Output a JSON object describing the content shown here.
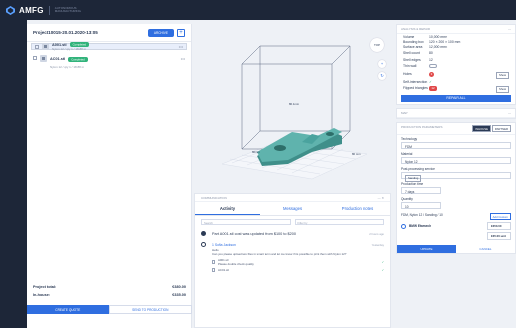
{
  "brand": {
    "name": "AMFG",
    "tagline": "AUTONOMOUS MANUFACTURING"
  },
  "project": {
    "name": "Project10015-20.01.2020-13:05",
    "action_label": "ARCHIVE",
    "add_label": "+",
    "parts": [
      {
        "name": "A001.stl",
        "sub": "Nylon 12 / qty 1 / 18.88 m",
        "badge": "Completed"
      },
      {
        "name": "AC01.stl",
        "sub": "Nylon 12 / qty 1 / 18.88 m",
        "badge": "Completed"
      }
    ],
    "totals": [
      {
        "label": "Project total:",
        "value": "€380.00"
      },
      {
        "label": "In-house:",
        "value": "€335.00"
      }
    ],
    "create_label": "CREATE QUOTE",
    "send_label": "SEND TO PRODUCTION"
  },
  "viewer": {
    "dim_label": "80.1mm",
    "dim_label2": "80mm",
    "dim_label3": "80 mm",
    "reset_label": "?",
    "toolbar": [
      "+",
      "↻"
    ]
  },
  "communication": {
    "header": "COMMUNICATION",
    "header_ctrl": "— ✕",
    "tabs": [
      "Activity",
      "Messages",
      "Production notes"
    ],
    "search_placeholder": "Search",
    "filter_placeholder": "Filter by",
    "event": {
      "text": "Part A001.stl cost was updated from $100 to $200",
      "time": "2 hours ago"
    },
    "message": {
      "author": "1 Sofia Jackson",
      "time": "Yesterday",
      "body": "Hello\nCan you please upload two files in smart term and let me know if its possible to print them with Nylon 12?",
      "attachments": [
        {
          "name": "A001.stl",
          "note": "Please double check quality"
        },
        {
          "name": "AC01.stl",
          "note": ""
        }
      ]
    }
  },
  "analysis": {
    "header": "ANALYSIS & REPAIR",
    "rows": [
      {
        "k": "Volume",
        "v": "10,000 mm³"
      },
      {
        "k": "Bounding box",
        "v": "120 × 200 × 100 mm"
      },
      {
        "k": "Surface area",
        "v": "12,000 mm²"
      },
      {
        "k": "Shell count",
        "v": "80"
      },
      {
        "k": "Shell edges",
        "v": "12"
      },
      {
        "k": "Thin wall",
        "v": ""
      },
      {
        "k": "Holes",
        "v": "3"
      },
      {
        "k": "Self-intersection",
        "v": "✓"
      },
      {
        "k": "Flipped triangles",
        "v": "12"
      }
    ],
    "repair_label": "REPAIR ALL",
    "view_label": "Show"
  },
  "production": {
    "map_label": "MAP",
    "header": "PRODUCTION PARAMETERS",
    "mode_a": "INHOUSE",
    "mode_b": "PARTNER",
    "fields": [
      {
        "label": "Technology",
        "value": "FDM"
      },
      {
        "label": "Material",
        "value": "Nylon 12"
      },
      {
        "label": "Post-processing service",
        "value": "Sanding"
      },
      {
        "label": "Production time",
        "value": "7 days"
      },
      {
        "label": "Quantity",
        "value": "10"
      }
    ],
    "summary": "FDM, Nylon 12 / Sanding / 10",
    "add_label": "Add Custom",
    "vendor": {
      "name": "BMW Etamech",
      "price": "€350.00",
      "price2": "€35.00 unit"
    },
    "update_label": "UPDATE",
    "cancel_label": "CANCEL"
  },
  "colors": {
    "accent": "#2f6ee0",
    "topbar": "#1d2638",
    "part": "#4aa39e",
    "completed": "#31b37b"
  }
}
